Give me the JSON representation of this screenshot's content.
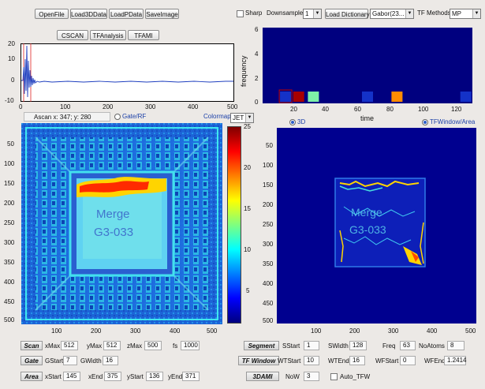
{
  "toolbar": {
    "open_file": "OpenFile",
    "load3d": "Load3DData",
    "loadp": "LoadPData",
    "save_image": "SaveImage",
    "cscan": "CSCAN",
    "tf_analysis": "TFAnalysis",
    "tfam": "TFAMI",
    "sharp_label": "Sharp",
    "downsample_label": "Downsample",
    "downsample_value": "1",
    "load_dictionary": "Load Dictionary",
    "dictionary_value": "Gabor(23...",
    "tf_methods_label": "TF Methods:",
    "tf_methods_value": "MP"
  },
  "ascan": {
    "y_ticks": [
      "20",
      "10",
      "0",
      "-10"
    ],
    "x_ticks": [
      "0",
      "100",
      "200",
      "300",
      "400",
      "500"
    ],
    "readout": "Ascan x: 347; y: 280",
    "gate_rf_label": "Gate/RF",
    "colormap_label": "Colormap",
    "colormap_value": "JET"
  },
  "freq_plot": {
    "ylabel": "frequency",
    "xlabel": "time",
    "y_ticks": [
      "6",
      "4",
      "2",
      "0"
    ],
    "x_ticks": [
      "20",
      "40",
      "60",
      "80",
      "100",
      "120"
    ],
    "radio_3d": "3D",
    "radio_tfwindow": "TFWindow/Area"
  },
  "chart_data": [
    {
      "type": "scatter",
      "xlabel": "time",
      "ylabel": "frequency",
      "xlim": [
        0,
        128
      ],
      "ylim": [
        0,
        6
      ],
      "points": [
        {
          "x": 14,
          "y": 0.5,
          "color": "#1432c8"
        },
        {
          "x": 22,
          "y": 0.5,
          "color": "#a80000"
        },
        {
          "x": 31,
          "y": 0.5,
          "color": "#7ef0a8"
        },
        {
          "x": 64,
          "y": 0.5,
          "color": "#1432c8"
        },
        {
          "x": 82,
          "y": 0.5,
          "color": "#ff8c00"
        },
        {
          "x": 124,
          "y": 0.5,
          "color": "#1432c8"
        }
      ]
    }
  ],
  "cscan": {
    "y_ticks": [
      "50",
      "100",
      "150",
      "200",
      "250",
      "300",
      "350",
      "400",
      "450",
      "500"
    ],
    "x_ticks": [
      "100",
      "200",
      "300",
      "400",
      "500"
    ],
    "overlay_text_1": "Merge",
    "overlay_text_2": "G3-033"
  },
  "colorbar": {
    "ticks": [
      "25",
      "20",
      "15",
      "10",
      "5"
    ],
    "colors": [
      "#00007f",
      "#0000ff",
      "#007fff",
      "#00ffff",
      "#7fff7f",
      "#ffff00",
      "#ff7f00",
      "#ff0000",
      "#7f0000"
    ]
  },
  "tfimage": {
    "y_ticks": [
      "50",
      "100",
      "150",
      "200",
      "250",
      "300",
      "350",
      "400",
      "450",
      "500"
    ],
    "x_ticks": [
      "100",
      "200",
      "300",
      "400",
      "500"
    ]
  },
  "scan_row": {
    "label": "Scan",
    "xmax_label": "xMax",
    "xmax": "512",
    "ymax_label": "yMax",
    "ymax": "512",
    "zmax_label": "zMax",
    "zmax": "500",
    "fs_label": "fs",
    "fs": "1000"
  },
  "gate_row": {
    "label": "Gate",
    "gstart_label": "GStart",
    "gstart": "7",
    "gwidth_label": "GWidth",
    "gwidth": "16"
  },
  "area_row": {
    "label": "Area",
    "xstart_label": "xStart",
    "xstart": "145",
    "xend_label": "xEnd",
    "xend": "375",
    "ystart_label": "yStart",
    "ystart": "136",
    "yend_label": "yEnd",
    "yend": "371"
  },
  "segment_row": {
    "label": "Segment",
    "sstart_label": "SStart",
    "sstart": "1",
    "swidth_label": "SWidth",
    "swidth": "128",
    "freq_label": "Freq",
    "freq": "63",
    "noatoms_label": "NoAtoms",
    "noatoms": "8"
  },
  "tfwindow_row": {
    "label": "TF Window",
    "wtstart_label": "WTStart",
    "wtstart": "10",
    "wtend_label": "WTEnd",
    "wtend": "16",
    "wfstart_label": "WFStart",
    "wfstart": "0",
    "wfend_label": "WFEnd",
    "wfend": "1.2414"
  },
  "ami_row": {
    "label": "3DAMI",
    "now_label": "NoW",
    "now": "3",
    "auto_tfw_label": "Auto_TFW"
  }
}
